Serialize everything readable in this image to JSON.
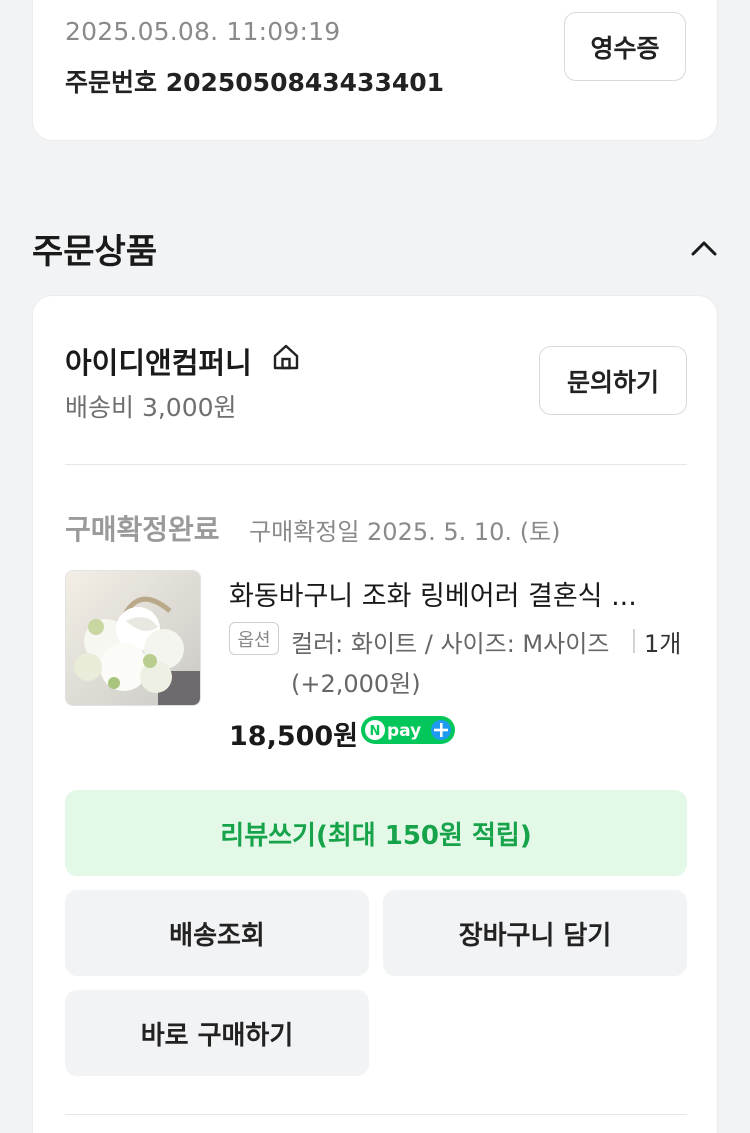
{
  "order": {
    "datetime": "2025.05.08. 11:09:19",
    "number": "주문번호 2025050843433401",
    "receipt_label": "영수증"
  },
  "section": {
    "title": "주문상품",
    "toggle_icon": "chevron-up-icon"
  },
  "store": {
    "name": "아이디앤컴퍼니",
    "home_icon": "home-icon",
    "shipping_fee": "배송비 3,000원",
    "inquiry_label": "문의하기"
  },
  "status": {
    "label": "구매확정완료",
    "confirm_date": "구매확정일 2025. 5. 10. (토)"
  },
  "product": {
    "name": "화동바구니 조화 링베어러 결혼식 ...",
    "option_badge": "옵션",
    "option_text": "컬러: 화이트 / 사이즈: M사이즈",
    "quantity": "1개",
    "option_price": "(+2,000원)",
    "price": "18,500원",
    "npay_label": "pay"
  },
  "actions": {
    "review": "리뷰쓰기(최대 150원 적립)",
    "track": "배송조회",
    "cart": "장바구니 담기",
    "buy_now": "바로 구매하기"
  },
  "colors": {
    "accent_green": "#17a34a",
    "review_bg": "#e3f8e7",
    "page_bg": "#f2f3f5"
  }
}
